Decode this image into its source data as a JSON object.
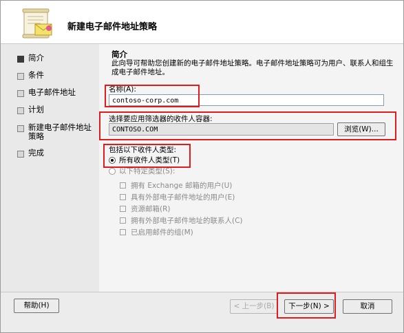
{
  "header": {
    "title": "新建电子邮件地址策略",
    "icon": "scroll-icon"
  },
  "nav": {
    "items": [
      {
        "label": "简介",
        "active": true
      },
      {
        "label": "条件",
        "active": false
      },
      {
        "label": "电子邮件地址",
        "active": false
      },
      {
        "label": "计划",
        "active": false
      },
      {
        "label": "新建电子邮件地址策略",
        "active": false
      },
      {
        "label": "完成",
        "active": false
      }
    ]
  },
  "main": {
    "section_title": "简介",
    "description": "此向导可帮助您创建新的电子邮件地址策略。电子邮件地址策略可为用户、联系人和组生成电子邮件地址。",
    "name_label": "名称(A):",
    "name_value": "contoso-corp.com",
    "container_label": "选择要应用筛选器的收件人容器:",
    "container_value": "CONTOSO.COM",
    "browse_label": "浏览(W)...",
    "include_label": "包括以下收件人类型:",
    "radio_all_label": "所有收件人类型(T)",
    "radio_specific_label": "以下特定类型(S):",
    "checkboxes": [
      "拥有 Exchange 邮箱的用户(U)",
      "具有外部电子邮件地址的用户(E)",
      "资源邮箱(R)",
      "拥有外部电子邮件地址的联系人(C)",
      "已启用邮件的组(M)"
    ]
  },
  "footer": {
    "help_label": "帮助(H)",
    "back_label": "< 上一步(B)",
    "next_label": "下一步(N) >",
    "cancel_label": "取消"
  },
  "colors": {
    "highlight": "#e01b1b",
    "nav_bg": "#e9e9e9",
    "content_bg": "#f4f4f4"
  }
}
